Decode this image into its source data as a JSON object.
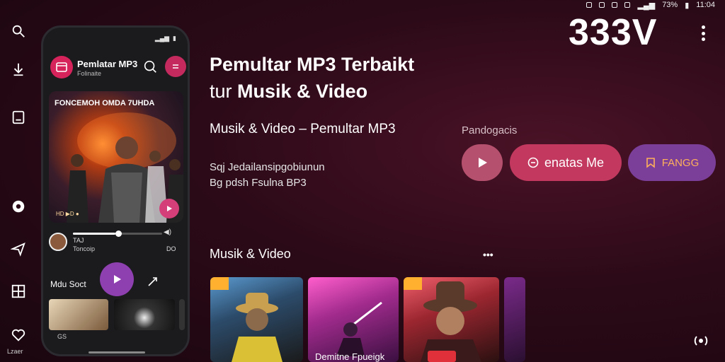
{
  "status_bar": {
    "battery": "73%",
    "time": "11:04"
  },
  "header": {
    "number": "333V"
  },
  "rail": {
    "caption": "Lzaer",
    "icons": [
      "search-icon",
      "download-icon",
      "queue-icon",
      "settings-icon",
      "send-icon",
      "grid-icon",
      "heart-icon"
    ]
  },
  "phone": {
    "app_title": "Pemlatar MP3",
    "app_subtitle": "Folinaite",
    "poster": {
      "title": "FONCEMOH OMDA 7UHDA",
      "meta": "HD  ▶D  ●"
    },
    "now_playing": {
      "label": "TAJ",
      "song": "Toncoip",
      "time": "DO"
    },
    "music_label": "Mdu Soct",
    "nav_left": "GS"
  },
  "hero": {
    "line1": "Pemultar MP3 Terbaikt",
    "line2_prefix": "tur",
    "line2_main": "Musik & Video",
    "subtitle": "Musik & Video – Pemultar MP3",
    "desc1": "Sqj Jedailansipgobiunun",
    "desc2": "Bg pdsh Fsulna BP3"
  },
  "actions": {
    "label": "Pandogacis",
    "pink_button": "enatas Me",
    "purple_button": "FANGG"
  },
  "section": {
    "title": "Musik & Video",
    "more": "•••"
  },
  "cards": [
    {
      "caption": ""
    },
    {
      "caption": "Demitne Fpueigk"
    },
    {
      "caption": ""
    },
    {
      "caption": ""
    }
  ],
  "colors": {
    "accent_pink": "#c2385f",
    "accent_purple": "#7b3f9a",
    "background": "#2c0a18"
  }
}
